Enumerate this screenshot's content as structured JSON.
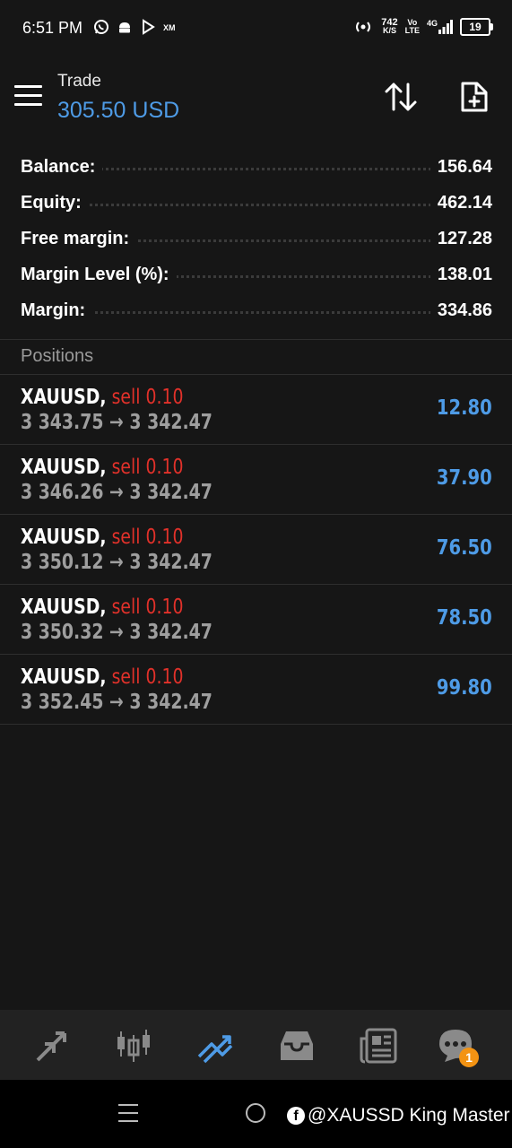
{
  "status_bar": {
    "time": "6:51 PM",
    "net_speed_value": "742",
    "net_speed_unit": "K/S",
    "volte_top": "Vo",
    "volte_bottom": "LTE",
    "network": "4G",
    "battery": "19",
    "icons": [
      "whatsapp-icon",
      "android-icon",
      "play-icon",
      "xm-icon",
      "hotspot-icon",
      "signal-icon"
    ]
  },
  "header": {
    "title": "Trade",
    "balance_display": "305.50 USD"
  },
  "summary": [
    {
      "label": "Balance:",
      "value": "156.64"
    },
    {
      "label": "Equity:",
      "value": "462.14"
    },
    {
      "label": "Free margin:",
      "value": "127.28"
    },
    {
      "label": "Margin Level (%):",
      "value": "138.01"
    },
    {
      "label": "Margin:",
      "value": "334.86"
    }
  ],
  "positions_header": "Positions",
  "positions": [
    {
      "symbol": "XAUUSD,",
      "side": "sell 0.10",
      "prices": "3 343.75 → 3 342.47",
      "profit": "12.80"
    },
    {
      "symbol": "XAUUSD,",
      "side": "sell 0.10",
      "prices": "3 346.26 → 3 342.47",
      "profit": "37.90"
    },
    {
      "symbol": "XAUUSD,",
      "side": "sell 0.10",
      "prices": "3 350.12 → 3 342.47",
      "profit": "76.50"
    },
    {
      "symbol": "XAUUSD,",
      "side": "sell 0.10",
      "prices": "3 350.32 → 3 342.47",
      "profit": "78.50"
    },
    {
      "symbol": "XAUUSD,",
      "side": "sell 0.10",
      "prices": "3 352.45 → 3 342.47",
      "profit": "99.80"
    }
  ],
  "bottom_nav": {
    "items": [
      "quotes-icon",
      "chart-icon",
      "trade-icon",
      "history-icon",
      "news-icon",
      "messages-icon"
    ],
    "active": "trade-icon",
    "messages_badge": "1",
    "active_color": "#4e9be6"
  },
  "watermark": "@XAUSSD King Master",
  "colors": {
    "accent": "#4e9be6",
    "sell": "#e2312a",
    "badge": "#f39313"
  }
}
